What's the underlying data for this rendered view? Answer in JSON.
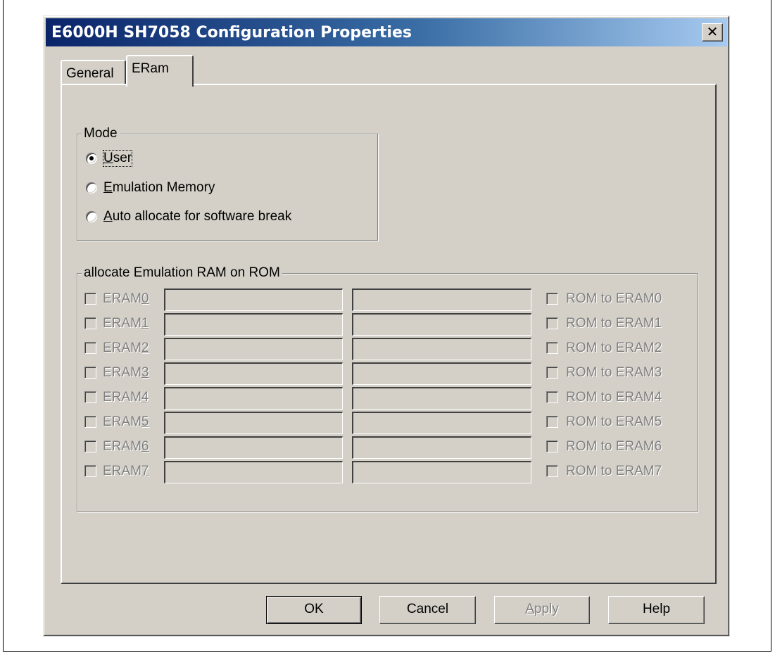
{
  "window": {
    "title": "E6000H SH7058 Configuration Properties",
    "close_glyph": "✕"
  },
  "tabs": [
    {
      "label": "General",
      "active": false
    },
    {
      "label": "ERam",
      "active": true
    }
  ],
  "mode_group": {
    "legend": "Mode",
    "options": [
      {
        "pre": "",
        "underline": "U",
        "post": "ser",
        "checked": true
      },
      {
        "pre": "",
        "underline": "E",
        "post": "mulation Memory",
        "checked": false
      },
      {
        "pre": "",
        "underline": "A",
        "post": "uto allocate for software break",
        "checked": false
      }
    ]
  },
  "eram_group": {
    "legend": "allocate Emulation RAM on ROM",
    "rows": [
      {
        "label_pre": "ERAM",
        "label_u": "0",
        "rom_label": "ROM to ERAM0",
        "start": "",
        "end": ""
      },
      {
        "label_pre": "ERAM",
        "label_u": "1",
        "rom_label": "ROM to ERAM1",
        "start": "",
        "end": ""
      },
      {
        "label_pre": "ERAM",
        "label_u": "2",
        "rom_label": "ROM to ERAM2",
        "start": "",
        "end": ""
      },
      {
        "label_pre": "ERAM",
        "label_u": "3",
        "rom_label": "ROM to ERAM3",
        "start": "",
        "end": ""
      },
      {
        "label_pre": "ERAM",
        "label_u": "4",
        "rom_label": "ROM to ERAM4",
        "start": "",
        "end": ""
      },
      {
        "label_pre": "ERAM",
        "label_u": "5",
        "rom_label": "ROM to ERAM5",
        "start": "",
        "end": ""
      },
      {
        "label_pre": "ERAM",
        "label_u": "6",
        "rom_label": "ROM to ERAM6",
        "start": "",
        "end": ""
      },
      {
        "label_pre": "ERAM",
        "label_u": "7",
        "rom_label": "ROM to ERAM7",
        "start": "",
        "end": ""
      }
    ]
  },
  "buttons": {
    "ok": "OK",
    "cancel": "Cancel",
    "apply_u": "A",
    "apply_rest": "pply",
    "help": "Help"
  }
}
